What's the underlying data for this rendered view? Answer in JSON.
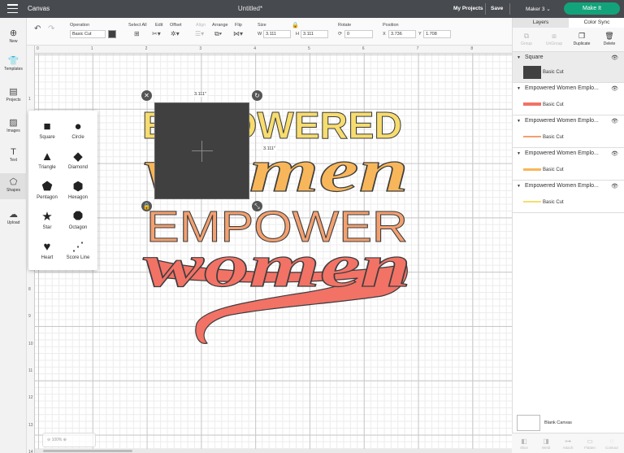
{
  "topbar": {
    "app_title": "Canvas",
    "doc_title": "Untitled*",
    "my_projects": "My Projects",
    "save": "Save",
    "machine": "Maker 3",
    "make_it": "Make It"
  },
  "toolbar": {
    "operation_label": "Operation",
    "operation_value": "Basic Cut",
    "select_all": "Select All",
    "edit": "Edit",
    "offset": "Offset",
    "align": "Align",
    "arrange": "Arrange",
    "flip": "Flip",
    "size_label": "Size",
    "w_label": "W",
    "w_value": "3.111",
    "h_label": "H",
    "h_value": "3.111",
    "rotate_label": "Rotate",
    "rotate_value": "0",
    "position_label": "Position",
    "x_label": "X",
    "x_value": "3.736",
    "y_label": "Y",
    "y_value": "1.708"
  },
  "sidebar": {
    "items": [
      {
        "label": "New",
        "icon": "plus-icon"
      },
      {
        "label": "Templates",
        "icon": "shirt-icon"
      },
      {
        "label": "Projects",
        "icon": "folder-icon"
      },
      {
        "label": "Images",
        "icon": "image-icon"
      },
      {
        "label": "Text",
        "icon": "text-icon"
      },
      {
        "label": "Shapes",
        "icon": "shapes-icon"
      },
      {
        "label": "Upload",
        "icon": "upload-icon"
      }
    ]
  },
  "shapes_menu": {
    "items": [
      {
        "label": "Square",
        "icon": "square-icon",
        "glyph": "■"
      },
      {
        "label": "Circle",
        "icon": "circle-icon",
        "glyph": "●"
      },
      {
        "label": "Triangle",
        "icon": "triangle-icon",
        "glyph": "▲"
      },
      {
        "label": "Diamond",
        "icon": "diamond-icon",
        "glyph": "◆"
      },
      {
        "label": "Pentagon",
        "icon": "pentagon-icon",
        "glyph": "⬟"
      },
      {
        "label": "Hexagon",
        "icon": "hexagon-icon",
        "glyph": "⬢"
      },
      {
        "label": "Star",
        "icon": "star-icon",
        "glyph": "★"
      },
      {
        "label": "Octagon",
        "icon": "octagon-icon",
        "glyph": "⯃"
      },
      {
        "label": "Heart",
        "icon": "heart-icon",
        "glyph": "♥"
      },
      {
        "label": "Score Line",
        "icon": "score-line-icon",
        "glyph": "⋰"
      }
    ]
  },
  "ruler": {
    "top": [
      "0",
      "1",
      "2",
      "3",
      "4",
      "5",
      "6",
      "7",
      "8"
    ],
    "left": [
      "1",
      "2",
      "3",
      "4",
      "5",
      "6",
      "7",
      "8",
      "9",
      "10",
      "11",
      "12",
      "13",
      "14"
    ]
  },
  "artwork": {
    "line1": "EMPOWERED",
    "line2": "women",
    "line3": "EMPOWER",
    "line4": "women",
    "colors": {
      "yellow": "#f7dc6f",
      "orange": "#f8b65a",
      "salmon": "#f3a070",
      "coral": "#f27266",
      "outline": "#3d3d3d"
    }
  },
  "selection": {
    "width_label": "3.111\"",
    "height_label": "3.111\""
  },
  "zoom": "100%",
  "panel": {
    "tab_layers": "Layers",
    "tab_color_sync": "Color Sync",
    "actions": [
      {
        "label": "Group"
      },
      {
        "label": "UnGroup"
      },
      {
        "label": "Duplicate"
      },
      {
        "label": "Delete"
      }
    ],
    "layers": [
      {
        "name": "Square",
        "cut": "Basic Cut",
        "color": "#404040"
      },
      {
        "name": "Empowered Women Emplo...",
        "cut": "Basic Cut",
        "color": "#f27266"
      },
      {
        "name": "Empowered Women Emplo...",
        "cut": "Basic Cut",
        "color": "#f3a070"
      },
      {
        "name": "Empowered Women Emplo...",
        "cut": "Basic Cut",
        "color": "#f8b65a"
      },
      {
        "name": "Empowered Women Emplo...",
        "cut": "Basic Cut",
        "color": "#f7dc6f"
      }
    ],
    "blank_canvas": "Blank Canvas",
    "bottom": [
      {
        "label": "Slice"
      },
      {
        "label": "Weld"
      },
      {
        "label": "Attach"
      },
      {
        "label": "Flatten"
      },
      {
        "label": "Contour"
      }
    ]
  }
}
